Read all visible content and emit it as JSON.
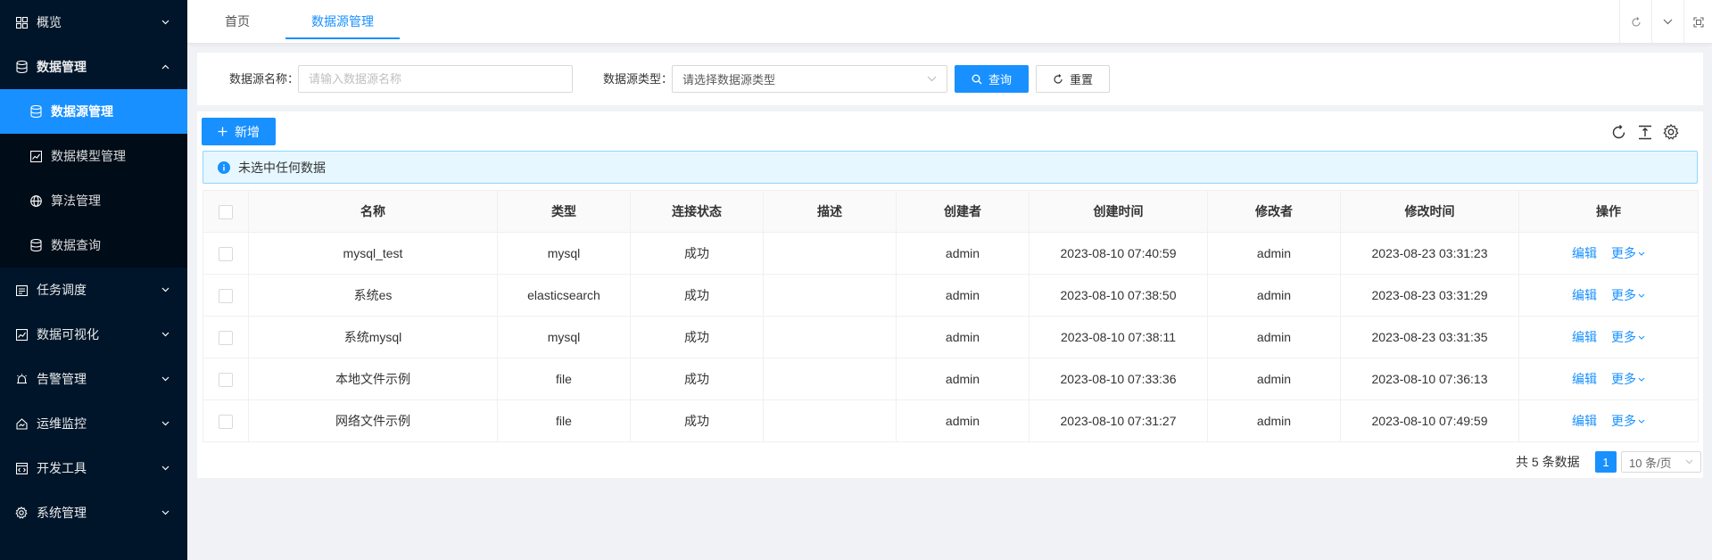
{
  "sidebar": {
    "items": [
      {
        "label": "概览",
        "icon": "grid-icon",
        "expanded": false
      },
      {
        "label": "数据管理",
        "icon": "database-icon",
        "expanded": true,
        "children": [
          {
            "label": "数据源管理",
            "icon": "database-icon",
            "active": true
          },
          {
            "label": "数据模型管理",
            "icon": "chart-icon",
            "active": false
          },
          {
            "label": "算法管理",
            "icon": "globe-icon",
            "active": false
          },
          {
            "label": "数据查询",
            "icon": "database-icon",
            "active": false
          }
        ]
      },
      {
        "label": "任务调度",
        "icon": "schedule-icon",
        "expanded": false
      },
      {
        "label": "数据可视化",
        "icon": "chart-icon",
        "expanded": false
      },
      {
        "label": "告警管理",
        "icon": "alarm-icon",
        "expanded": false
      },
      {
        "label": "运维监控",
        "icon": "monitor-icon",
        "expanded": false
      },
      {
        "label": "开发工具",
        "icon": "devtool-icon",
        "expanded": false
      },
      {
        "label": "系统管理",
        "icon": "settings-icon",
        "expanded": false
      }
    ]
  },
  "tabs": [
    {
      "label": "首页",
      "active": false
    },
    {
      "label": "数据源管理",
      "active": true
    }
  ],
  "search": {
    "name_label": "数据源名称：",
    "name_placeholder": "请输入数据源名称",
    "type_label": "数据源类型：",
    "type_placeholder": "请选择数据源类型",
    "query_label": "查询",
    "reset_label": "重置"
  },
  "toolbar": {
    "add_label": "新增"
  },
  "alert": {
    "text": "未选中任何数据"
  },
  "table": {
    "columns": [
      "名称",
      "类型",
      "连接状态",
      "描述",
      "创建者",
      "创建时间",
      "修改者",
      "修改时间",
      "操作"
    ],
    "rows": [
      {
        "name": "mysql_test",
        "type": "mysql",
        "status": "成功",
        "desc": "",
        "creator": "admin",
        "created": "2023-08-10 07:40:59",
        "modifier": "admin",
        "modified": "2023-08-23 03:31:23"
      },
      {
        "name": "系统es",
        "type": "elasticsearch",
        "status": "成功",
        "desc": "",
        "creator": "admin",
        "created": "2023-08-10 07:38:50",
        "modifier": "admin",
        "modified": "2023-08-23 03:31:29"
      },
      {
        "name": "系统mysql",
        "type": "mysql",
        "status": "成功",
        "desc": "",
        "creator": "admin",
        "created": "2023-08-10 07:38:11",
        "modifier": "admin",
        "modified": "2023-08-23 03:31:35"
      },
      {
        "name": "本地文件示例",
        "type": "file",
        "status": "成功",
        "desc": "",
        "creator": "admin",
        "created": "2023-08-10 07:33:36",
        "modifier": "admin",
        "modified": "2023-08-10 07:36:13"
      },
      {
        "name": "网络文件示例",
        "type": "file",
        "status": "成功",
        "desc": "",
        "creator": "admin",
        "created": "2023-08-10 07:31:27",
        "modifier": "admin",
        "modified": "2023-08-10 07:49:59"
      }
    ],
    "edit_label": "编辑",
    "more_label": "更多"
  },
  "pagination": {
    "total_text": "共 5 条数据",
    "current_page": "1",
    "page_size": "10 条/页"
  },
  "colors": {
    "sidebar_bg": "#001529",
    "accent": "#1890ff",
    "alert_bg": "#e6f7ff"
  }
}
